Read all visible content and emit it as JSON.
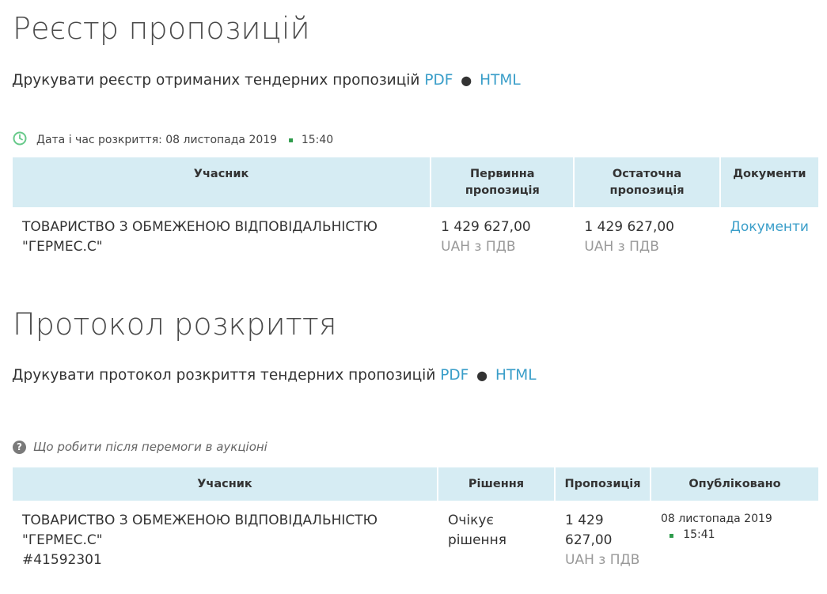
{
  "registry": {
    "title": "Реєстр пропозицій",
    "print_text": "Друкувати реєстр отриманих тендерних пропозицій",
    "pdf_label": "PDF",
    "dot": "●",
    "html_label": "HTML",
    "opening_label": "Дата і час розкриття: 08 листопада 2019",
    "opening_sep": "▪",
    "opening_time": "15:40",
    "table": {
      "headers": [
        "Учасник",
        "Первинна пропозиція",
        "Остаточна пропозиція",
        "Документи"
      ],
      "rows": [
        {
          "participant": "ТОВАРИСТВО З ОБМЕЖЕНОЮ ВІДПОВІДАЛЬНІСТЮ \"ГЕРМЕС.С\"",
          "initial_amount": "1 429 627,00",
          "initial_currency": "UAH з ПДВ",
          "final_amount": "1 429 627,00",
          "final_currency": "UAH з ПДВ",
          "documents_link": "Документи"
        }
      ]
    }
  },
  "protocol": {
    "title": "Протокол розкриття",
    "print_text": "Друкувати протокол розкриття тендерних пропозицій",
    "pdf_label": "PDF",
    "dot": "●",
    "html_label": "HTML",
    "help_text": "Що робити після перемоги в аукціоні",
    "table": {
      "headers": [
        "Учасник",
        "Рішення",
        "Пропозиція",
        "Опубліковано"
      ],
      "rows": [
        {
          "participant": "ТОВАРИСТВО З ОБМЕЖЕНОЮ ВІДПОВІДАЛЬНІСТЮ \"ГЕРМЕС.С\"",
          "participant_id": "#41592301",
          "decision": "Очікує рішення",
          "amount": "1 429 627,00",
          "currency": "UAH з ПДВ",
          "published_date": "08 листопада 2019",
          "published_sep": "▪",
          "published_time": "15:41"
        }
      ]
    }
  },
  "colors": {
    "link": "#3a9ec9",
    "header_bg": "#d6ecf3",
    "clock_icon": "#67c98a",
    "separator_green": "#2e9b4b",
    "muted_text": "#999999"
  },
  "icons": [
    "clock-icon",
    "question-circle-icon"
  ]
}
